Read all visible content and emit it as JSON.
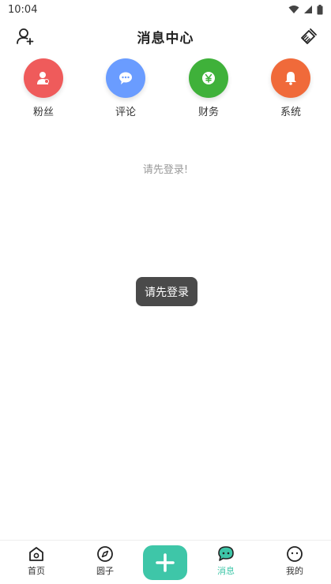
{
  "status_bar": {
    "time": "10:04"
  },
  "header": {
    "title": "消息中心"
  },
  "categories": [
    {
      "label": "粉丝",
      "color": "#ef5b5b",
      "icon": "user-badge-icon"
    },
    {
      "label": "评论",
      "color": "#6a9cff",
      "icon": "chat-bubble-icon"
    },
    {
      "label": "财务",
      "color": "#3fb13a",
      "icon": "yen-icon"
    },
    {
      "label": "系统",
      "color": "#f06a3a",
      "icon": "bell-icon"
    }
  ],
  "main": {
    "empty_text": "请先登录!"
  },
  "toast": {
    "text": "请先登录"
  },
  "bottom_nav": {
    "items": [
      {
        "label": "首页",
        "icon": "home-icon"
      },
      {
        "label": "圆子",
        "icon": "compass-icon"
      },
      {
        "label": "消息",
        "icon": "message-icon",
        "active": true
      },
      {
        "label": "我的",
        "icon": "profile-face-icon"
      }
    ],
    "add_icon": "plus-icon",
    "accent_color": "#3ec6a8"
  }
}
